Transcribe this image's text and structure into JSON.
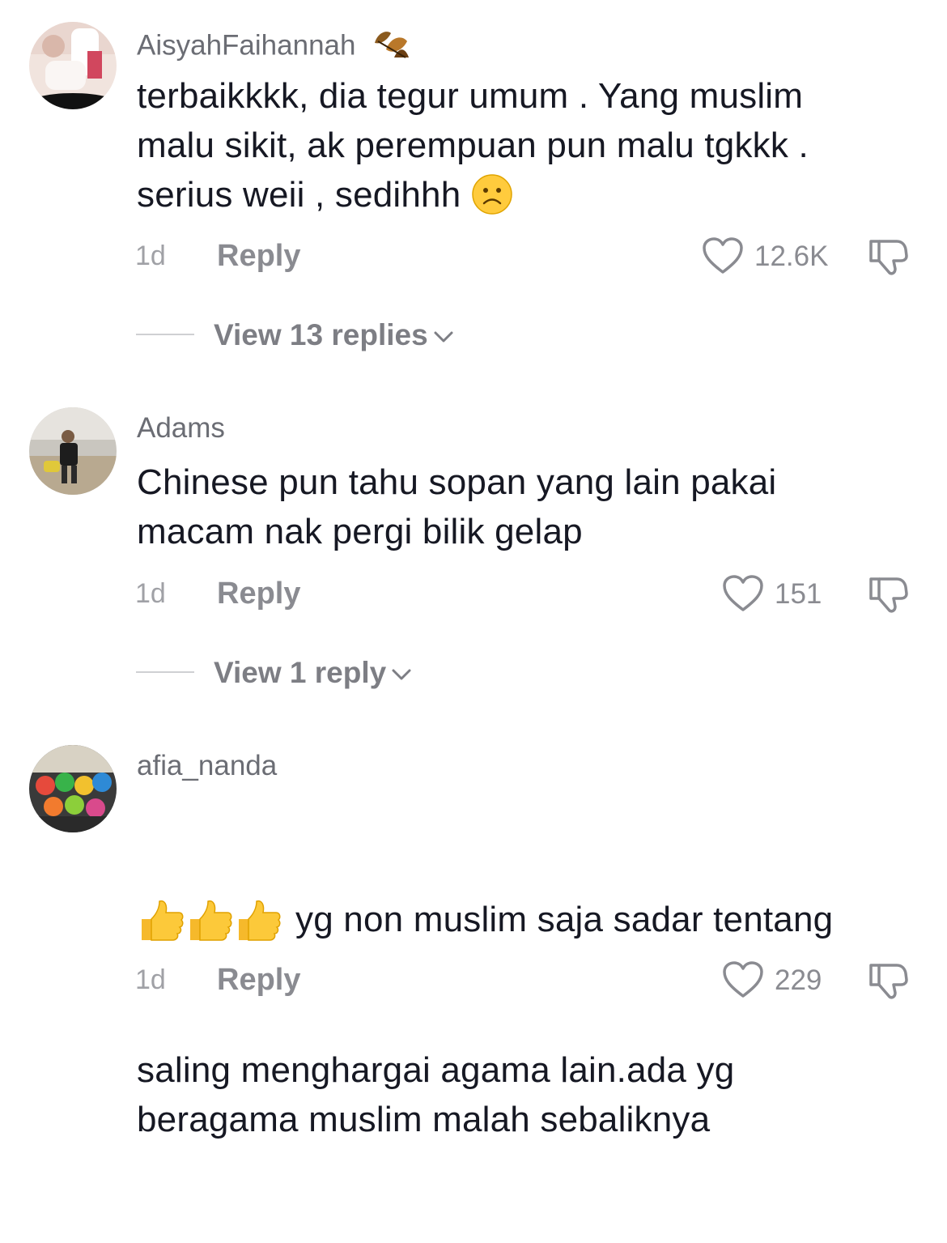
{
  "comments": [
    {
      "username": "AisyahFaihannah",
      "username_badge_icon": "leaves-icon",
      "text": "terbaikkkk, dia tegur umum . Yang muslim\nmalu sikit, ak perempuan pun malu tgkkk .\nserius weii , sedihhh",
      "trailing_emoji": "frowning-face-emoji",
      "time": "1d",
      "reply_label": "Reply",
      "likes": "12.6K",
      "view_replies": "View 13 replies"
    },
    {
      "username": "Adams",
      "text": "Chinese pun tahu sopan yang lain pakai\nmacam nak pergi bilik gelap",
      "time": "1d",
      "reply_label": "Reply",
      "likes": "151",
      "view_replies": "View 1 reply"
    },
    {
      "username": "afia_nanda",
      "leading_emoji": [
        "thumbs-up-emoji",
        "thumbs-up-emoji",
        "thumbs-up-emoji"
      ],
      "text_first_line": "yg non muslim saja sadar tentang",
      "text_rest": "saling menghargai agama lain.ada yg\nberagama muslim malah sebaliknya",
      "time": "1d",
      "reply_label": "Reply",
      "likes": "229"
    }
  ],
  "colors": {
    "text": "#161823",
    "secondary": "#8a8b91",
    "username": "#6b6d74"
  }
}
